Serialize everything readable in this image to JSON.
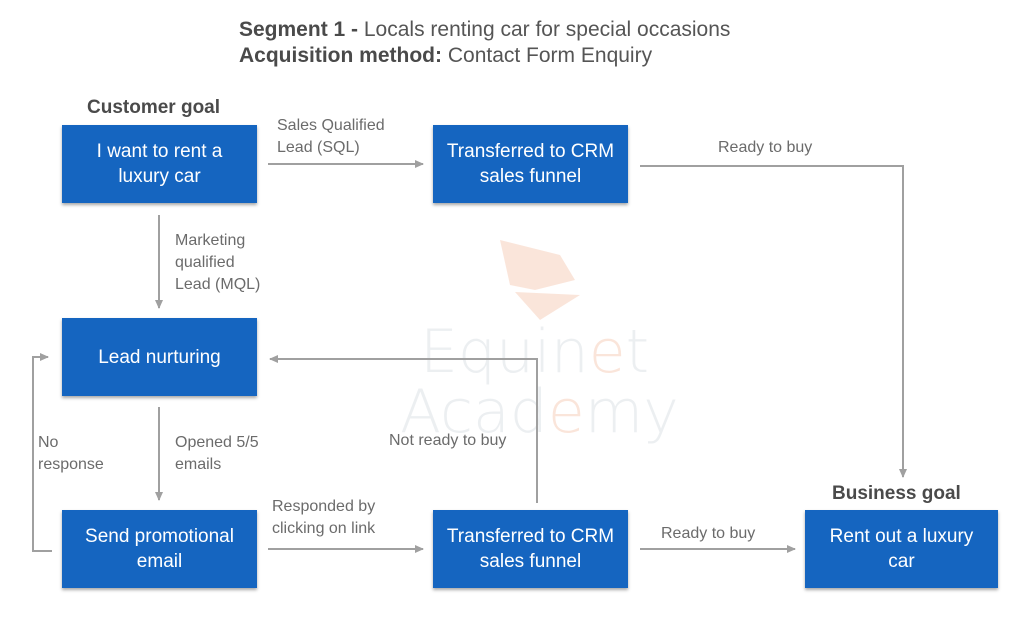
{
  "title": {
    "line1_bold": "Segment 1 -",
    "line1_rest": "Locals renting car for special occasions",
    "line2_bold": "Acquisition method:",
    "line2_rest": "Contact Form Enquiry"
  },
  "headings": {
    "customer_goal": "Customer goal",
    "business_goal": "Business goal"
  },
  "nodes": {
    "want_rent": "I want to rent a\nluxury car",
    "crm_top": "Transferred to CRM\nsales funnel",
    "lead_nurturing": "Lead nurturing",
    "send_email": "Send promotional\nemail",
    "crm_bottom": "Transferred to CRM\nsales funnel",
    "rent_out": "Rent out a luxury\ncar"
  },
  "edges": {
    "sql": "Sales Qualified\nLead (SQL)",
    "ready_top": "Ready to buy",
    "mql": "Marketing\nqualified\nLead (MQL)",
    "opened": "Opened 5/5\nemails",
    "no_response": "No\nresponse",
    "not_ready": "Not ready to buy",
    "responded": "Responded by\nclicking on link",
    "ready_bottom": "Ready to buy"
  },
  "watermark": {
    "line1_a": "Equin",
    "line1_b": "e",
    "line1_c": "t",
    "line2_a": "Acad",
    "line2_b": "e",
    "line2_c": "my"
  },
  "colors": {
    "box": "#1565c0",
    "arrow": "#a0a0a0"
  }
}
